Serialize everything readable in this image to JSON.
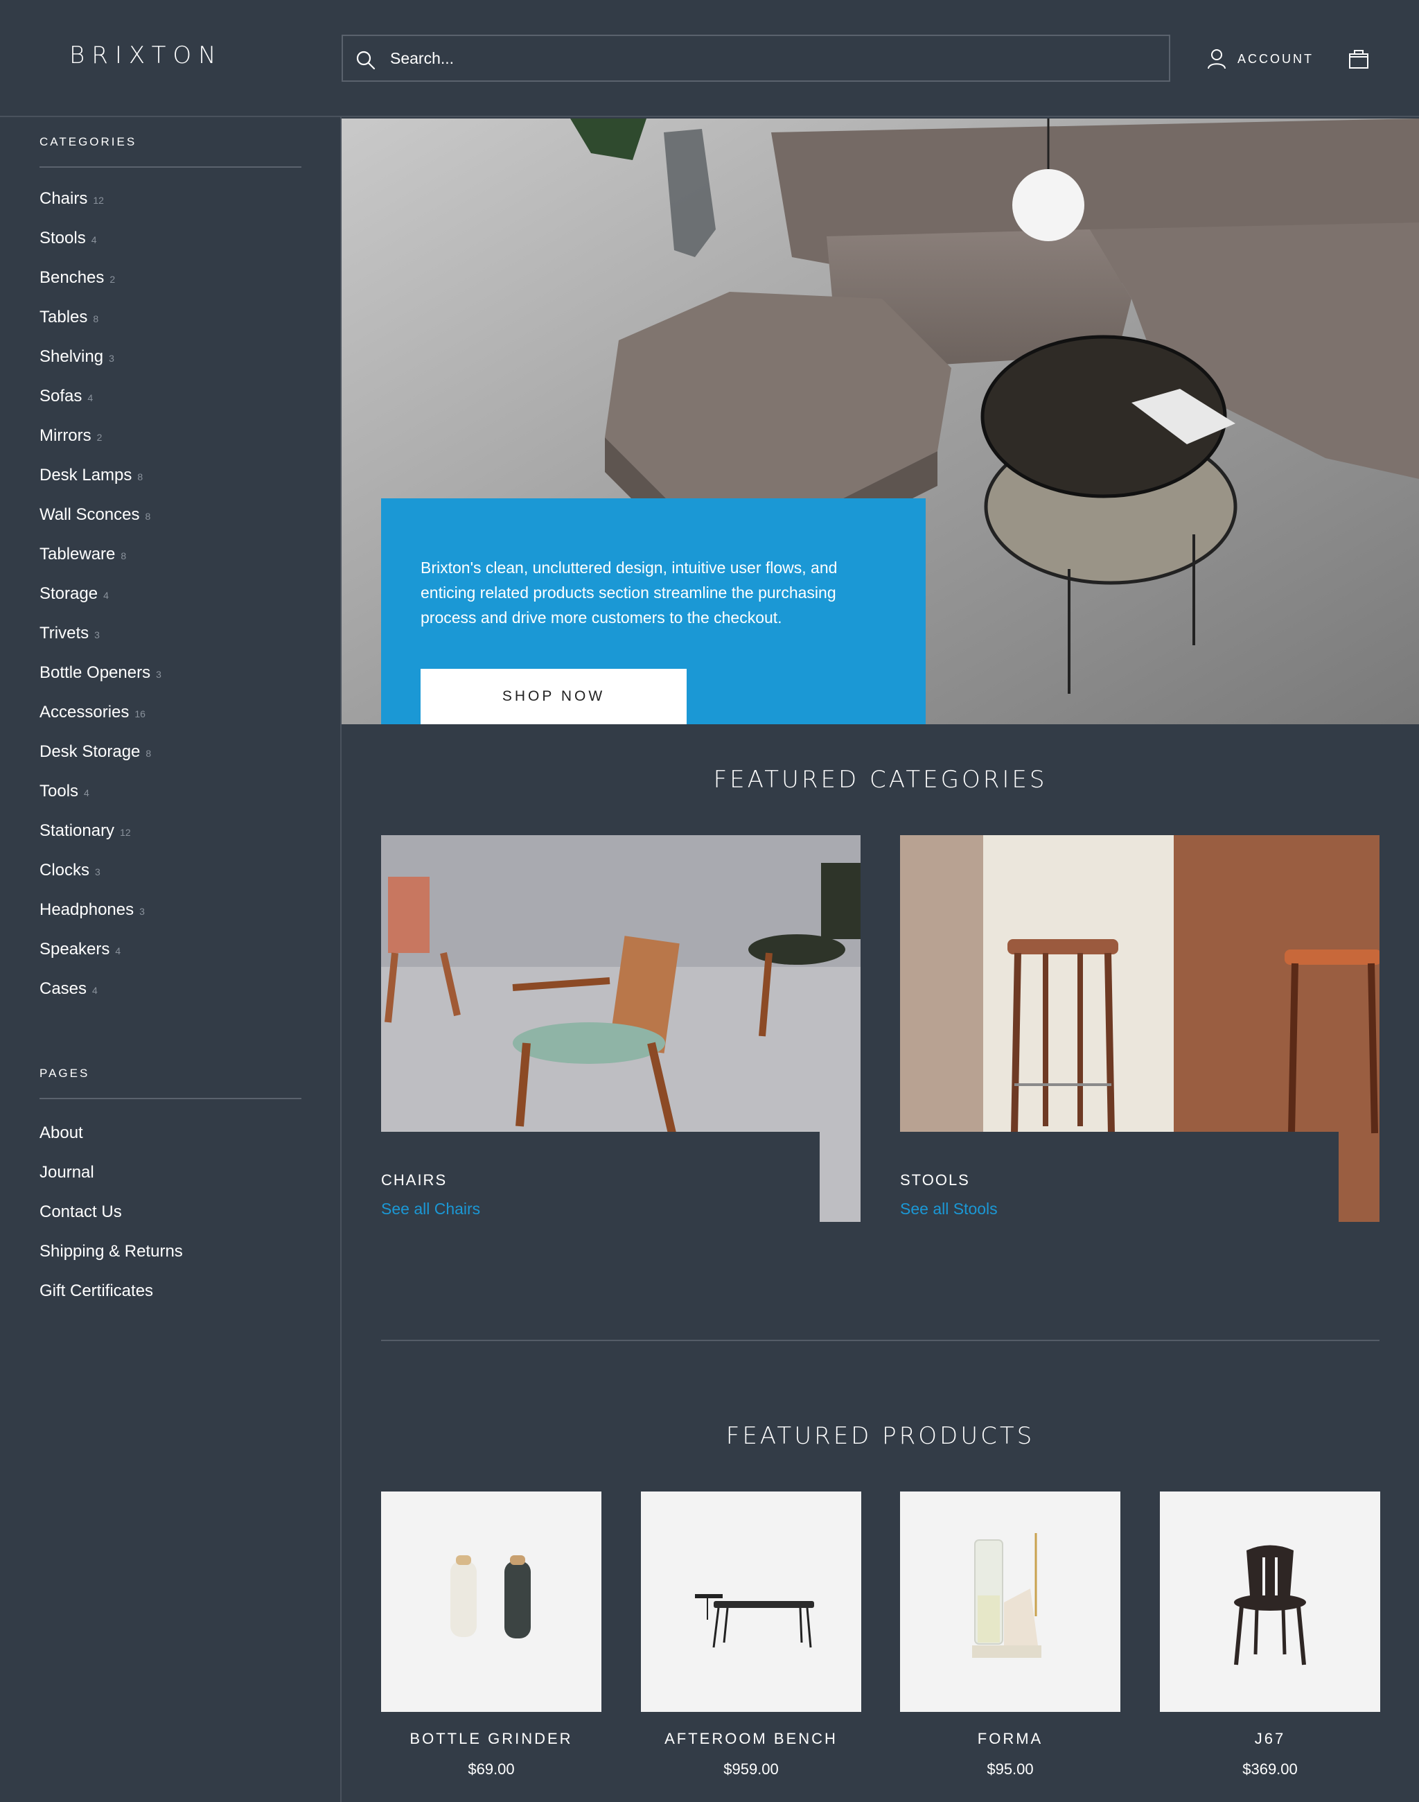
{
  "header": {
    "logo": "BRIXTON",
    "search_placeholder": "Search...",
    "account_label": "ACCOUNT"
  },
  "sidebar": {
    "categories_heading": "CATEGORIES",
    "categories": [
      {
        "label": "Chairs",
        "count": "12"
      },
      {
        "label": "Stools",
        "count": "4"
      },
      {
        "label": "Benches",
        "count": "2"
      },
      {
        "label": "Tables",
        "count": "8"
      },
      {
        "label": "Shelving",
        "count": "3"
      },
      {
        "label": "Sofas",
        "count": "4"
      },
      {
        "label": "Mirrors",
        "count": "2"
      },
      {
        "label": "Desk Lamps",
        "count": "8"
      },
      {
        "label": "Wall Sconces",
        "count": "8"
      },
      {
        "label": "Tableware",
        "count": "8"
      },
      {
        "label": "Storage",
        "count": "4"
      },
      {
        "label": "Trivets",
        "count": "3"
      },
      {
        "label": "Bottle Openers",
        "count": "3"
      },
      {
        "label": "Accessories",
        "count": "16"
      },
      {
        "label": "Desk Storage",
        "count": "8"
      },
      {
        "label": "Tools",
        "count": "4"
      },
      {
        "label": "Stationary",
        "count": "12"
      },
      {
        "label": "Clocks",
        "count": "3"
      },
      {
        "label": "Headphones",
        "count": "3"
      },
      {
        "label": "Speakers",
        "count": "4"
      },
      {
        "label": "Cases",
        "count": "4"
      }
    ],
    "pages_heading": "PAGES",
    "pages": [
      "About",
      "Journal",
      "Contact Us",
      "Shipping & Returns",
      "Gift Certificates"
    ]
  },
  "hero": {
    "text": "Brixton's clean, uncluttered design, intuitive user flows, and enticing related products section streamline the purchasing process and drive more customers to the checkout.",
    "button": "SHOP NOW",
    "prev_icon": "‹",
    "next_icon": "›"
  },
  "featured_categories": {
    "title": "FEATURED CATEGORIES",
    "items": [
      {
        "name": "CHAIRS",
        "link": "See all Chairs"
      },
      {
        "name": "STOOLS",
        "link": "See all Stools"
      }
    ]
  },
  "featured_products": {
    "title": "FEATURED PRODUCTS",
    "items": [
      {
        "name": "BOTTLE GRINDER",
        "price": "$69.00"
      },
      {
        "name": "AFTEROOM BENCH",
        "price": "$959.00"
      },
      {
        "name": "FORMA",
        "price": "$95.00"
      },
      {
        "name": "J67",
        "price": "$369.00"
      }
    ]
  },
  "colors": {
    "background": "#333c47",
    "accent": "#1b98d5",
    "product_bg": "#f3f3f3"
  },
  "icons": {
    "search": "search-icon",
    "account": "user-icon",
    "cart": "bag-icon"
  }
}
